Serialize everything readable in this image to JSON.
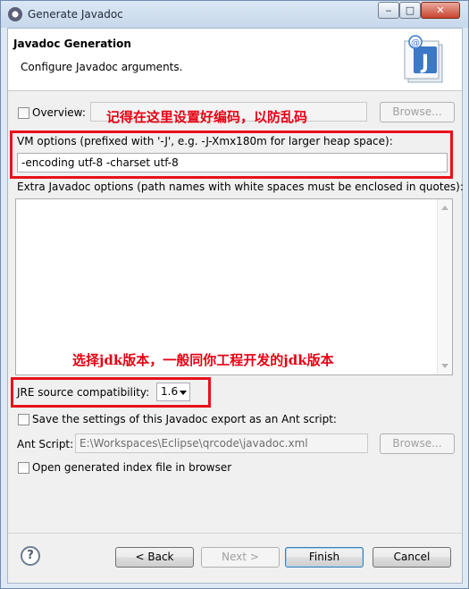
{
  "window": {
    "title": "Generate Javadoc"
  },
  "banner": {
    "title": "Javadoc Generation",
    "description": "Configure Javadoc arguments."
  },
  "overview": {
    "label": "Overview:",
    "value": "",
    "browse_label": "Browse..."
  },
  "vm_options": {
    "label": "VM options (prefixed with '-J', e.g. -J-Xmx180m for larger heap space):",
    "value": "-encoding utf-8 -charset utf-8"
  },
  "extra_options": {
    "label": "Extra Javadoc options (path names with white spaces must be enclosed in quotes):",
    "value": ""
  },
  "jre": {
    "label": "JRE source compatibility:",
    "selected": "1.6"
  },
  "save_ant": {
    "label": "Save the settings of this Javadoc export as an Ant script:"
  },
  "ant_script": {
    "label": "Ant Script:",
    "value": "E:\\Workspaces\\Eclipse\\qrcode\\javadoc.xml",
    "browse_label": "Browse..."
  },
  "open_index": {
    "label": "Open generated index file in browser"
  },
  "annotations": {
    "encoding_note": "记得在这里设置好编码，以防乱码",
    "jdk_note": "选择jdk版本，一般同你工程开发的jdk版本"
  },
  "footer": {
    "help": "?",
    "back": "< Back",
    "next": "Next >",
    "finish": "Finish",
    "cancel": "Cancel"
  },
  "colors": {
    "annotation_red": "#e8111a"
  }
}
